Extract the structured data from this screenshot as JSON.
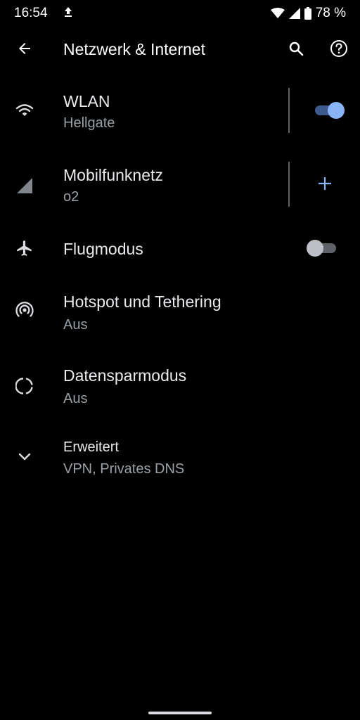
{
  "status_bar": {
    "time": "16:54",
    "battery": "78 %",
    "icons": [
      "upload-icon",
      "wifi-icon",
      "cell-signal-icon",
      "battery-icon"
    ]
  },
  "header": {
    "title": "Netzwerk & Internet",
    "back_icon": "arrow-back-icon",
    "search_icon": "search-icon",
    "help_icon": "help-icon"
  },
  "items": [
    {
      "title": "WLAN",
      "subtitle": "Hellgate",
      "icon": "wifi-icon",
      "toggle_on": true
    },
    {
      "title": "Mobilfunknetz",
      "subtitle": "o2",
      "icon": "cell-signal-icon",
      "action_icon": "add-icon"
    },
    {
      "title": "Flugmodus",
      "icon": "airplane-icon",
      "toggle_on": false
    },
    {
      "title": "Hotspot und Tethering",
      "subtitle": "Aus",
      "icon": "hotspot-icon"
    },
    {
      "title": "Datensparmodus",
      "subtitle": "Aus",
      "icon": "data-saver-icon"
    },
    {
      "title": "Erweitert",
      "subtitle": "VPN, Privates DNS",
      "icon": "chevron-down-icon"
    }
  ],
  "colors": {
    "background": "#000000",
    "primary_text": "#e8eaed",
    "secondary_text": "#9aa0a6",
    "accent": "#8ab4f8"
  }
}
